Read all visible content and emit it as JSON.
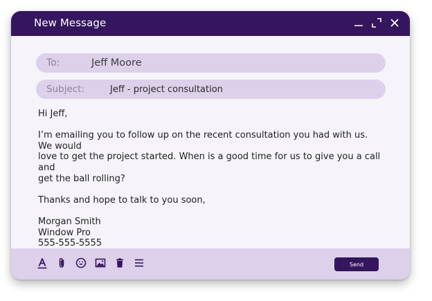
{
  "window": {
    "title": "New Message",
    "controls": {
      "minimize_icon": "minimize-icon",
      "expand_icon": "expand-icon",
      "close_icon": "close-icon"
    }
  },
  "colors": {
    "header": "#35155e",
    "field_background": "#ddd0ea",
    "window_background": "#f6f4fa",
    "footer_background": "#ddd0ea",
    "send_button": "#35155e"
  },
  "to": {
    "label": "To:",
    "value": "Jeff Moore"
  },
  "subject": {
    "label": "Subject:",
    "value": "Jeff - project consultation"
  },
  "message": {
    "greeting": "Hi Jeff,",
    "body_lines": [
      "I’m emailing you to follow up on the recent consultation you had with us. We would",
      "love to get the project started. When is a good time for us to give you a call and",
      "get the ball rolling?"
    ],
    "closing": "Thanks and hope to talk to you soon,",
    "signature_name": "Morgan Smith",
    "signature_company": "Window Pro",
    "signature_phone": "555-555-5555"
  },
  "toolbar": {
    "icons": [
      "text-format-icon",
      "attachment-icon",
      "emoji-icon",
      "image-icon",
      "trash-icon",
      "menu-icon"
    ],
    "send_label": "Send"
  }
}
